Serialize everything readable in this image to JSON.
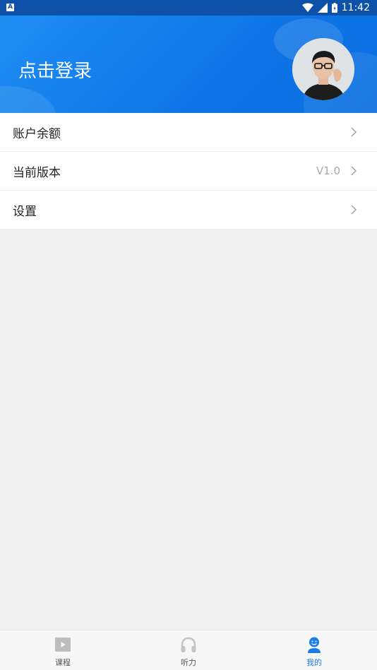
{
  "status_bar": {
    "time": "11:42",
    "notification_icon": "A"
  },
  "header": {
    "login_label": "点击登录"
  },
  "menu": [
    {
      "label": "账户余额",
      "value": ""
    },
    {
      "label": "当前版本",
      "value": "V1.0"
    },
    {
      "label": "设置",
      "value": ""
    }
  ],
  "tabs": [
    {
      "label": "课程",
      "icon": "play-video-icon",
      "active": false
    },
    {
      "label": "听力",
      "icon": "headphones-icon",
      "active": false
    },
    {
      "label": "我的",
      "icon": "profile-icon",
      "active": true
    }
  ],
  "colors": {
    "accent": "#1a7ee8",
    "header": "#0e74e6",
    "statusbar": "#0d52a8"
  }
}
